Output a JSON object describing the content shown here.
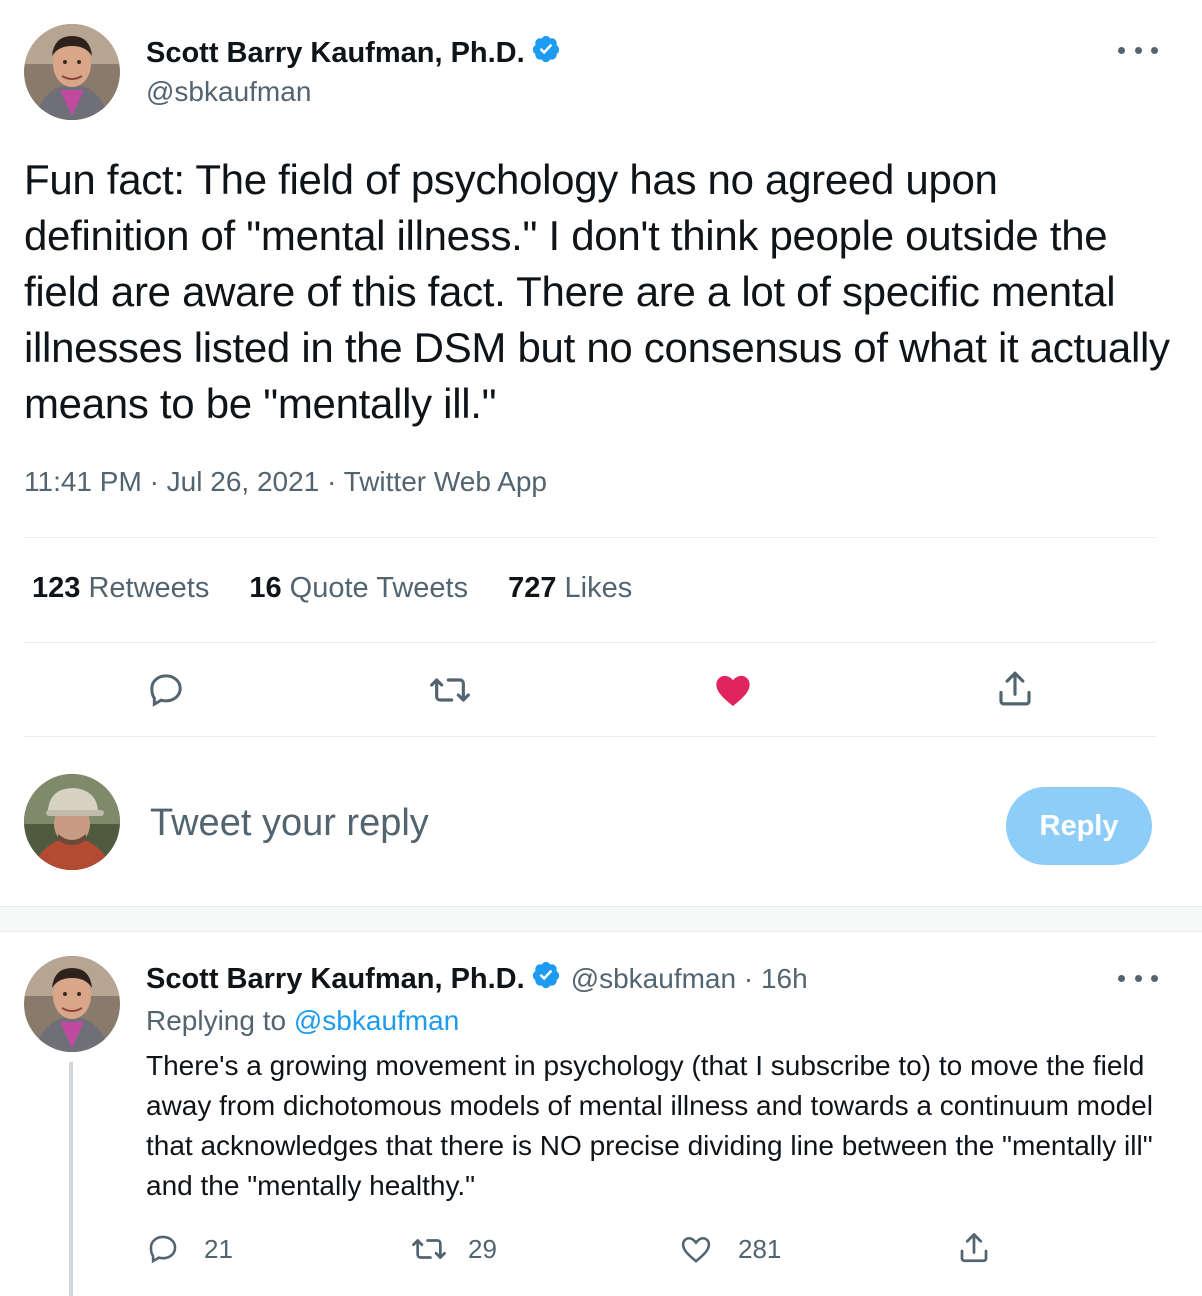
{
  "main_tweet": {
    "author_name": "Scott Barry Kaufman, Ph.D.",
    "handle": "@sbkaufman",
    "text": "Fun fact: The field of psychology has no agreed upon definition of \"mental illness.\" I don't think people outside the field are aware of this fact. There are a lot of specific mental illnesses listed in the DSM but no consensus of what it actually means to be \"mentally ill.\"",
    "time": "11:41 PM",
    "date": "Jul 26, 2021",
    "source": "Twitter Web App",
    "separator": "·",
    "stats": {
      "retweets_count": "123",
      "retweets_label": "Retweets",
      "quotes_count": "16",
      "quotes_label": "Quote Tweets",
      "likes_count": "727",
      "likes_label": "Likes"
    },
    "liked": true
  },
  "compose": {
    "placeholder": "Tweet your reply",
    "button_label": "Reply"
  },
  "reply_tweet": {
    "author_name": "Scott Barry Kaufman, Ph.D.",
    "handle_time": "@sbkaufman · 16h",
    "replying_prefix": "Replying to",
    "replying_mention": "@sbkaufman",
    "text": "There's a growing movement in psychology (that I subscribe to) to move the field away from dichotomous models of mental illness and towards a continuum model that acknowledges that there is NO precise dividing line between the \"mentally ill\" and the \"mentally healthy.\"",
    "reply_count": "21",
    "retweet_count": "29",
    "like_count": "281"
  },
  "colors": {
    "accent": "#1d9bf0",
    "like": "#e0245e",
    "secondary_text": "#536471",
    "reply_button": "#8ecdf8"
  },
  "icons": [
    "verified-icon",
    "more-icon",
    "reply-icon",
    "retweet-icon",
    "like-icon",
    "share-icon"
  ]
}
